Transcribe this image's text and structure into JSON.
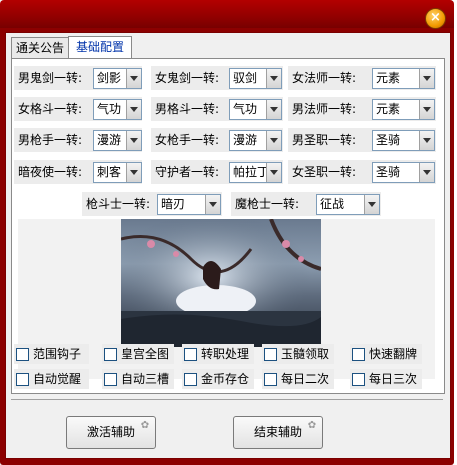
{
  "window": {
    "close_glyph": "×"
  },
  "tabs": [
    {
      "label": "通关公告"
    },
    {
      "label": "基础配置"
    }
  ],
  "config_rows": [
    [
      {
        "label": "男鬼剑一转:",
        "value": "剑影"
      },
      {
        "label": "女鬼剑一转:",
        "value": "驭剑"
      },
      {
        "label": "女法师一转:",
        "value": "元素"
      }
    ],
    [
      {
        "label": "女格斗一转:",
        "value": "气功"
      },
      {
        "label": "男格斗一转:",
        "value": "气功"
      },
      {
        "label": "男法师一转:",
        "value": "元素"
      }
    ],
    [
      {
        "label": "男枪手一转:",
        "value": "漫游"
      },
      {
        "label": "女枪手一转:",
        "value": "漫游"
      },
      {
        "label": "男圣职一转:",
        "value": "圣骑"
      }
    ],
    [
      {
        "label": "暗夜使一转:",
        "value": "刺客"
      },
      {
        "label": "守护者一转:",
        "value": "帕拉丁"
      },
      {
        "label": "女圣职一转:",
        "value": "圣骑"
      }
    ]
  ],
  "extra_row": [
    {
      "label": "枪斗士一转:",
      "value": "暗刃"
    },
    {
      "label": "魔枪士一转:",
      "value": "征战"
    }
  ],
  "checkboxes_row1": [
    "范围钩子",
    "皇宫全图",
    "转职处理",
    "玉髓领取",
    "快速翻牌"
  ],
  "checkboxes_row2": [
    "自动觉醒",
    "自动三槽",
    "金币存仓",
    "每日二次",
    "每日三次"
  ],
  "buttons": {
    "activate": "激活辅助",
    "end": "结束辅助"
  },
  "colors": {
    "title_bar": "#8c0000",
    "close_button": "#f29a00",
    "active_tab_text": "#0033aa"
  }
}
